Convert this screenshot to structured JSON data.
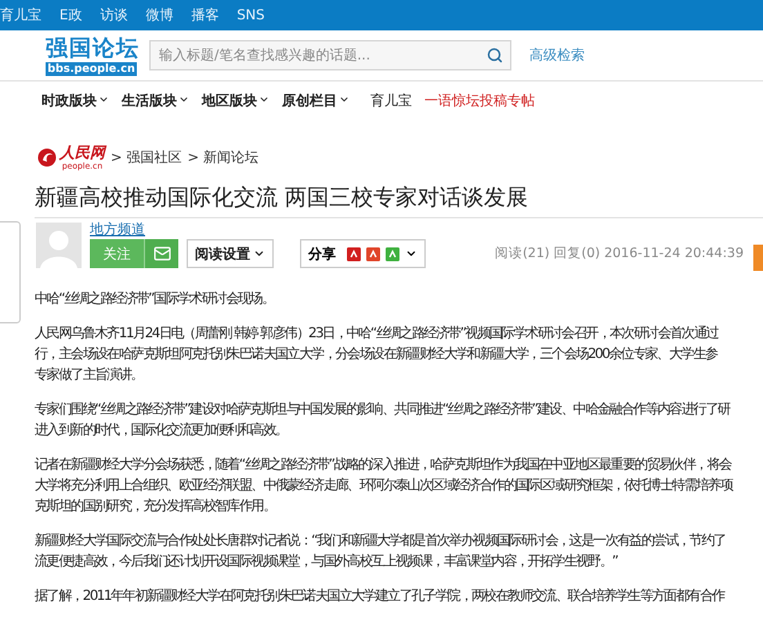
{
  "top_bar": {
    "links": [
      "育儿宝",
      "E政",
      "访谈",
      "微博",
      "播客",
      "SNS"
    ]
  },
  "header": {
    "logo_title": "强国论坛",
    "logo_domain": "bbs.people.cn",
    "search": {
      "placeholder": "输入标题/笔名查找感兴趣的话题..."
    },
    "advanced_search": "高级检索"
  },
  "nav": {
    "items": [
      {
        "label": "时政版块",
        "kind": "menu"
      },
      {
        "label": "生活版块",
        "kind": "menu"
      },
      {
        "label": "地区版块",
        "kind": "menu"
      },
      {
        "label": "原创栏目",
        "kind": "menu"
      },
      {
        "label": "育儿宝",
        "kind": "link"
      },
      {
        "label": "一语惊坛投稿专帖",
        "kind": "highlight"
      }
    ]
  },
  "breadcrumb": {
    "logo_text": "人民网",
    "logo_domain": "people.cn",
    "items": [
      "> 强国社区",
      "> 新闻论坛"
    ]
  },
  "article": {
    "title": "新疆高校推动国际化交流 两国三校专家对话谈发展",
    "author": "地方频道",
    "follow_button": "关注",
    "reading_settings": "阅读设置",
    "share_label": "分享",
    "stats": "阅读(21) 回复(0)  2016-11-24 20:44:39",
    "paragraphs": [
      [
        "中哈“丝绸之路经济带”国际学术研讨会现场。"
      ],
      [
        "人民网乌鲁木齐11月24日电（周蕾刚 韩婷 郭彦伟）23日，中哈“丝绸之路经济带”视频国际学术研讨会召开，本次研讨会首次通过",
        "行，主会场设在哈萨克斯坦阿克托别朱巴诺夫国立大学，分会场设在新疆财经大学和新疆大学，三个会场200余位专家、大学生参",
        "专家做了主旨演讲。"
      ],
      [
        "专家们围绕“丝绸之路经济带”建设对哈萨克斯坦与中国发展的影响、共同推进“丝绸之路经济带”建设、中哈金融合作等内容进行了研",
        "进入到新的时代，国际化交流更加便利和高效。"
      ],
      [
        "记者在新疆财经大学分会场获悉，随着“丝绸之路经济带”战略的深入推进，哈萨克斯坦作为我国在中亚地区最重要的贸易伙伴，将会",
        "大学将充分利用上合组织、欧亚经济联盟、中俄蒙经济走廊、环阿尔泰山次区域经济合作的国际区域研究框架，依托博士特需培养项",
        "克斯坦的国别研究，充分发挥高校智库作用。"
      ],
      [
        "新疆财经大学国际交流与合作处处长唐群对记者说：“我们和新疆大学都是首次举办视频国际研讨会，这是一次有益的尝试，节约了",
        "流更便捷高效，今后我们还计划开设国际视频课堂，与国外高校互上视频课，丰富课堂内容，开拓学生视野。”"
      ],
      [
        "据了解，2011年年初新疆财经大学在阿克托别朱巴诺夫国立大学建立了孔子学院，两校在教师交流、联合培养学生等方面都有合作"
      ]
    ]
  }
}
